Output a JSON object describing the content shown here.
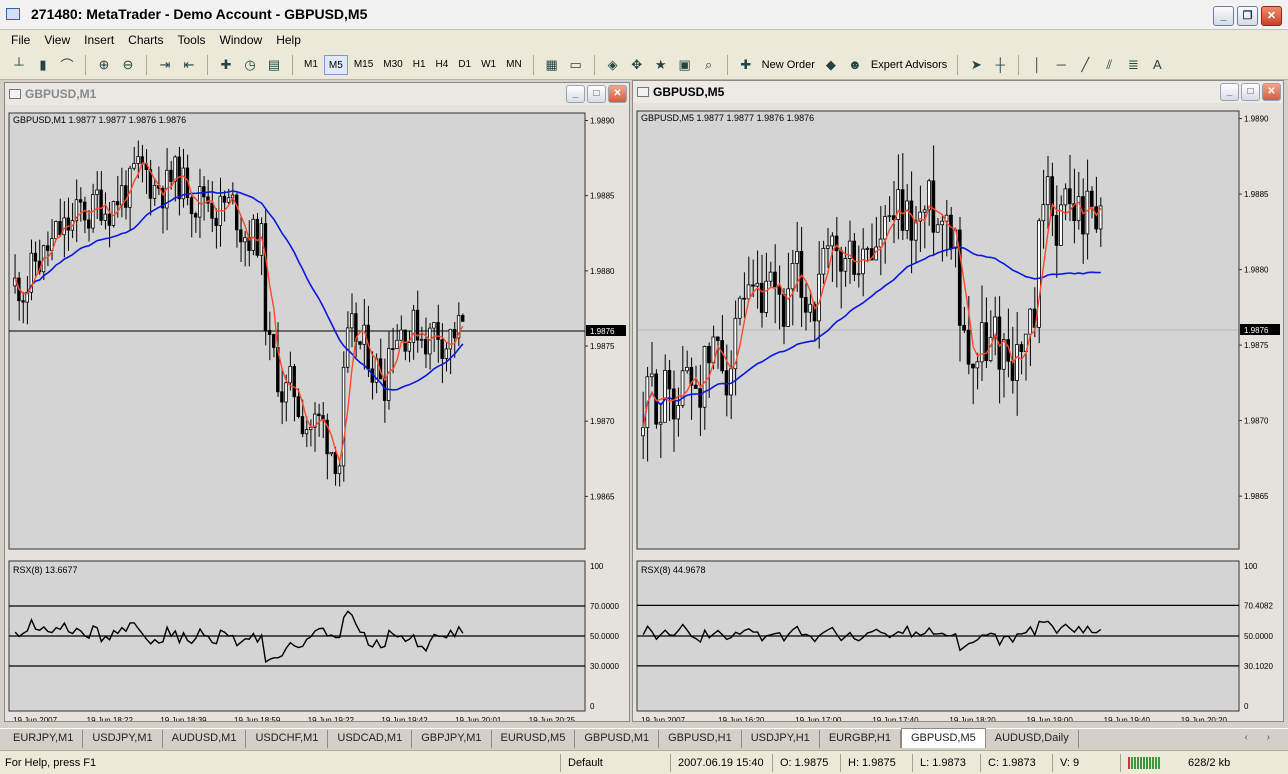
{
  "window": {
    "title": "271480: MetaTrader - Demo Account - GBPUSD,M5"
  },
  "menu": [
    "File",
    "View",
    "Insert",
    "Charts",
    "Tools",
    "Window",
    "Help"
  ],
  "toolbar": {
    "periods": [
      "M1",
      "M5",
      "M15",
      "M30",
      "H1",
      "H4",
      "D1",
      "W1",
      "MN"
    ],
    "active_period": "M5",
    "new_order": "New Order",
    "expert_advisors": "Expert Advisors",
    "text_tool": "A"
  },
  "charts": [
    {
      "window_title": "GBPUSD,M1",
      "header": "GBPUSD,M1  1.9877 1.9877 1.9876 1.9876",
      "price_labels": [
        "1.9890",
        "1.9885",
        "1.9880",
        "1.9875",
        "1.9870",
        "1.9865"
      ],
      "current_price": "1.9876",
      "indicator": "RSX(8) 13.6677",
      "indicator_levels": [
        "100",
        "70.0000",
        "50.0000",
        "30.0000",
        "0"
      ],
      "time_labels": [
        "19 Jun 2007",
        "19 Jun 18:22",
        "19 Jun 18:39",
        "19 Jun 18:59",
        "19 Jun 19:22",
        "19 Jun 19:42",
        "19 Jun 20:01",
        "19 Jun 20:25"
      ]
    },
    {
      "window_title": "GBPUSD,M5",
      "header": "GBPUSD,M5  1.9877 1.9877 1.9876 1.9876",
      "price_labels": [
        "1.9890",
        "1.9885",
        "1.9880",
        "1.9875",
        "1.9870",
        "1.9865"
      ],
      "current_price": "1.9876",
      "indicator": "RSX(8) 44.9678",
      "indicator_levels": [
        "100",
        "70.4082",
        "50.0000",
        "30.1020",
        "0"
      ],
      "time_labels": [
        "19 Jun 2007",
        "19 Jun 16:20",
        "19 Jun 17:00",
        "19 Jun 17:40",
        "19 Jun 18:20",
        "19 Jun 19:00",
        "19 Jun 19:40",
        "19 Jun 20:20"
      ]
    }
  ],
  "tabs": [
    "EURJPY,M1",
    "USDJPY,M1",
    "AUDUSD,M1",
    "USDCHF,M1",
    "USDCAD,M1",
    "GBPJPY,M1",
    "EURUSD,M5",
    "GBPUSD,M1",
    "GBPUSD,H1",
    "USDJPY,H1",
    "EURGBP,H1",
    "GBPUSD,M5",
    "AUDUSD,Daily"
  ],
  "active_tab": "GBPUSD,M5",
  "status": {
    "help": "For Help, press F1",
    "profile": "Default",
    "datetime": "2007.06.19 15:40",
    "open": "O: 1.9875",
    "high": "H: 1.9875",
    "low": "L: 1.9873",
    "close": "C: 1.9873",
    "volume": "V: 9",
    "traffic": "628/2 kb"
  },
  "colors": {
    "chart_bg": "#d4d4d4",
    "fast_ma": "#ff4a2a",
    "slow_ma": "#0a18e0",
    "price_highlight": "#000000"
  }
}
